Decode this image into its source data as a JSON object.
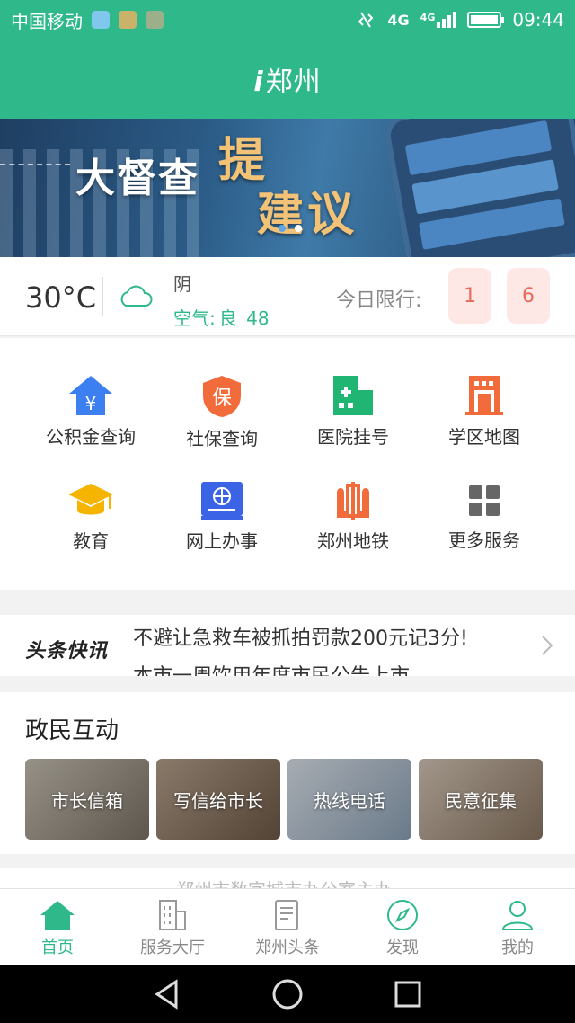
{
  "status_bar": {
    "carrier": "中国移动",
    "network": "4G",
    "network2": "4G",
    "time": "09:44"
  },
  "header": {
    "title_prefix": "i",
    "title": "郑州"
  },
  "banner": {
    "main_text": "大督查",
    "accent1": "提",
    "accent2": "建议",
    "slide_count": 2,
    "active_slide": 2
  },
  "weather": {
    "temperature": "30°C",
    "condition": "阴",
    "air_label": "空气:",
    "air_quality": "良",
    "air_index": "48",
    "limit_label": "今日限行:",
    "plates": [
      "1",
      "6"
    ]
  },
  "services": [
    {
      "label": "公积金查询",
      "icon": "housing-fund-icon"
    },
    {
      "label": "社保查询",
      "icon": "social-security-icon"
    },
    {
      "label": "医院挂号",
      "icon": "hospital-icon"
    },
    {
      "label": "学区地图",
      "icon": "school-district-icon"
    },
    {
      "label": "教育",
      "icon": "graduation-cap-icon"
    },
    {
      "label": "网上办事",
      "icon": "online-service-icon"
    },
    {
      "label": "郑州地铁",
      "icon": "metro-icon"
    },
    {
      "label": "更多服务",
      "icon": "grid-icon"
    }
  ],
  "headline": {
    "logo": "头条快讯",
    "line1": "不避让急救车被抓拍罚款200元记3分!",
    "line2": "本市一周饮用年度市民公告上市..."
  },
  "interaction": {
    "title": "政民互动",
    "cards": [
      {
        "label": "市长信箱"
      },
      {
        "label": "写信给市长"
      },
      {
        "label": "热线电话"
      },
      {
        "label": "民意征集"
      }
    ]
  },
  "footer_peek": {
    "text": "郑州市数字城市办公室主办"
  },
  "tabbar": [
    {
      "label": "首页",
      "icon": "home-icon",
      "active": true
    },
    {
      "label": "服务大厅",
      "icon": "building-icon",
      "active": false
    },
    {
      "label": "郑州头条",
      "icon": "news-icon",
      "active": false
    },
    {
      "label": "发现",
      "icon": "compass-icon",
      "active": false
    },
    {
      "label": "我的",
      "icon": "user-icon",
      "active": false
    }
  ],
  "colors": {
    "brand": "#2fb98a",
    "plate_bg": "#fde8e6",
    "plate_text": "#e96a5b"
  }
}
